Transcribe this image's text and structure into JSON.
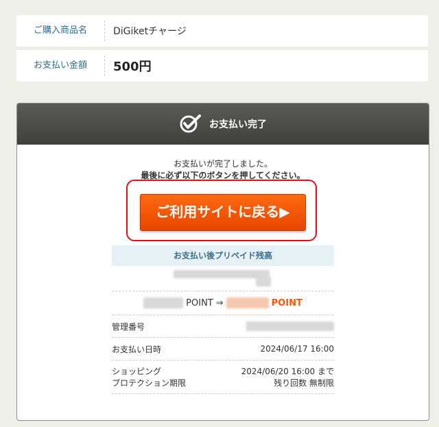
{
  "product": {
    "name_label": "ご購入商品名",
    "name_value": "DiGiketチャージ",
    "amount_label": "お支払い金額",
    "amount_value": "500円"
  },
  "panel": {
    "title": "お支払い完了",
    "message_line1": "お支払いが完了しました。",
    "message_line2": "最後に必ず以下のボタンを押してください。",
    "return_button": "ご利用サイトに戻る▶"
  },
  "balance": {
    "header": "お支払い後プリペイド残高",
    "point_label": "POINT",
    "arrow": "⇒",
    "point_label_new": "POINT"
  },
  "details": {
    "management_label": "管理番号",
    "date_label": "お支払い日時",
    "date_value": "2024/06/17 16:00",
    "protection_label_line1": "ショッピング",
    "protection_label_line2": "プロテクション期限",
    "protection_value_line1": "2024/06/20 16:00 まで",
    "protection_value_line2": "残り回数 無制限"
  },
  "colors": {
    "accent": "#ff5500",
    "link": "#2e6e8e",
    "alert_border": "#e01010"
  }
}
